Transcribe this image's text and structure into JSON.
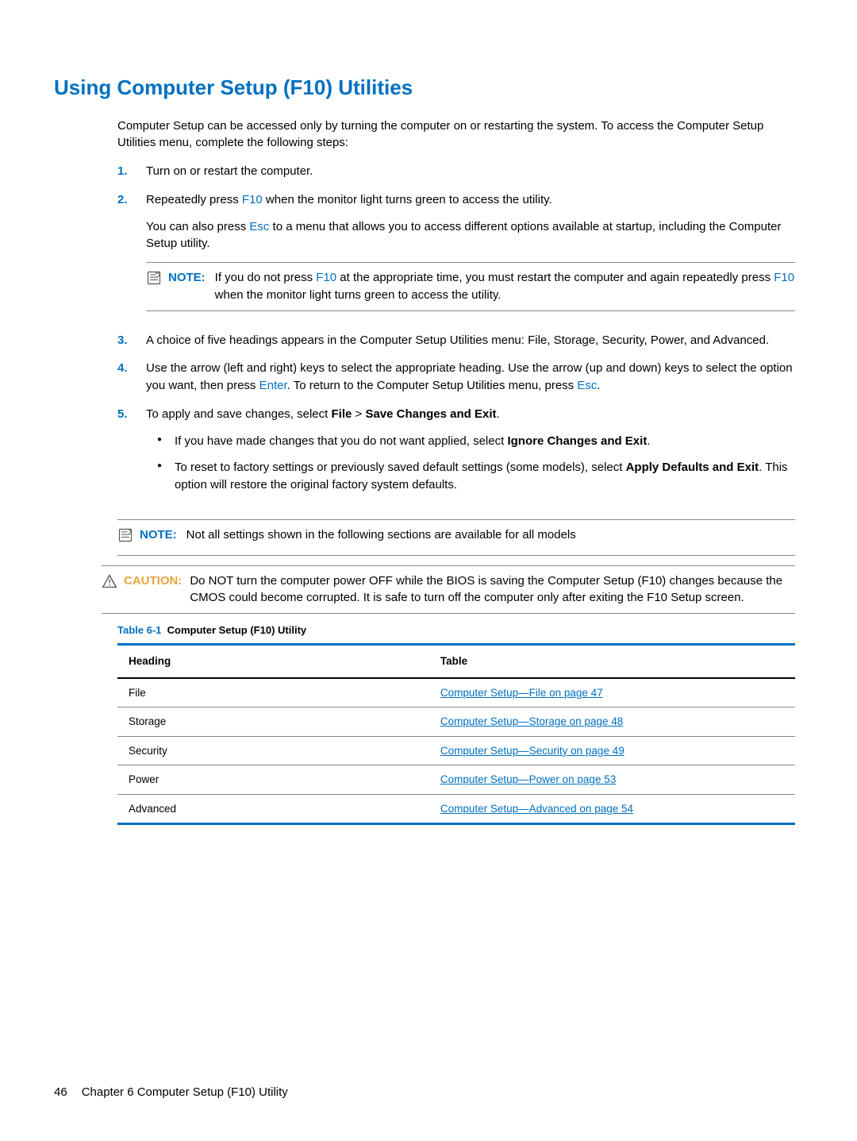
{
  "title": "Using Computer Setup (F10) Utilities",
  "intro": "Computer Setup can be accessed only by turning the computer on or restarting the system. To access the Computer Setup Utilities menu, complete the following steps:",
  "steps": {
    "s1": "Turn on or restart the computer.",
    "s2a": "Repeatedly press ",
    "s2b": " when the monitor light turns green to access the utility.",
    "s2c": "You can also press ",
    "s2d": " to a menu that allows you to access different options available at startup, including the Computer Setup utility.",
    "s3": "A choice of five headings appears in the Computer Setup Utilities menu: File, Storage, Security, Power, and Advanced.",
    "s4a": "Use the arrow (left and right) keys to select the appropriate heading. Use the arrow (up and down) keys to select the option you want, then press ",
    "s4b": ". To return to the Computer Setup Utilities menu, press ",
    "s4c": ".",
    "s5a": "To apply and save changes, select ",
    "s5b": " > ",
    "s5c": ".",
    "s5_bullet1a": "If you have made changes that you do not want applied, select ",
    "s5_bullet1b": ".",
    "s5_bullet2a": "To reset to factory settings or previously saved default settings (some models), select ",
    "s5_bullet2b": ". This option will restore the original factory system defaults."
  },
  "keys": {
    "f10": "F10",
    "esc": "Esc",
    "enter": "Enter"
  },
  "bold_items": {
    "file": "File",
    "save_exit": "Save Changes and Exit",
    "ignore_exit": "Ignore Changes and Exit",
    "apply_defaults": "Apply Defaults and Exit"
  },
  "notes": {
    "note_label": "NOTE:",
    "note1a": "If you do not press ",
    "note1b": " at the appropriate time, you must restart the computer and again repeatedly press ",
    "note1c": " when the monitor light turns green to access the utility.",
    "note2": "Not all settings shown in the following sections are available for all models"
  },
  "caution": {
    "label": "CAUTION:",
    "text": "Do NOT turn the computer power OFF while the BIOS is saving the Computer Setup (F10) changes because the CMOS could become corrupted. It is safe to turn off the computer only after exiting the F10 Setup screen."
  },
  "table": {
    "caption_num": "Table 6-1",
    "caption_text": "Computer Setup (F10) Utility",
    "head_col1": "Heading",
    "head_col2": "Table",
    "rows": [
      {
        "heading": "File",
        "link": "Computer Setup—File on page 47"
      },
      {
        "heading": "Storage",
        "link": "Computer Setup—Storage on page 48"
      },
      {
        "heading": "Security",
        "link": "Computer Setup—Security on page 49"
      },
      {
        "heading": "Power",
        "link": "Computer Setup—Power on page 53"
      },
      {
        "heading": "Advanced",
        "link": "Computer Setup—Advanced on page 54"
      }
    ]
  },
  "footer": {
    "page_num": "46",
    "chapter": "Chapter 6   Computer Setup (F10) Utility"
  }
}
